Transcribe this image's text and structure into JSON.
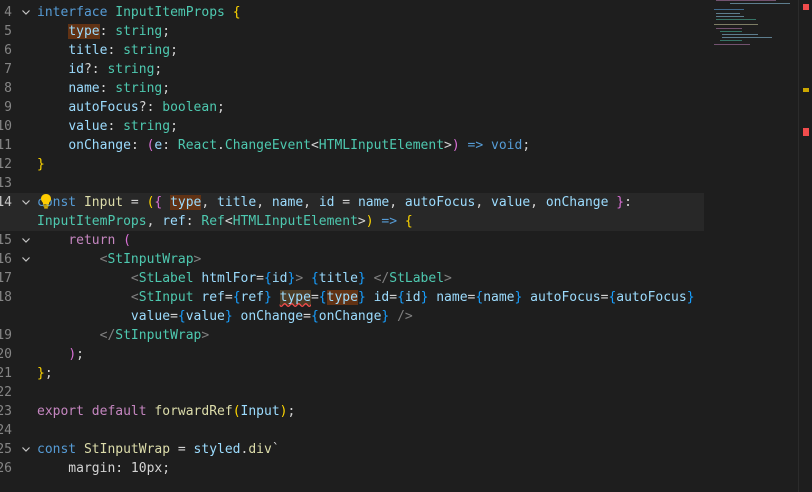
{
  "editor": {
    "language": "typescriptreact",
    "active_line": "14",
    "lines": [
      {
        "n": "4",
        "fold": "open",
        "segs": [
          [
            "kw",
            "interface "
          ],
          [
            "ty",
            "InputItemProps "
          ],
          [
            "b1",
            "{"
          ]
        ]
      },
      {
        "n": "5",
        "segs": [
          [
            "txt",
            "    "
          ],
          [
            "vr hl",
            "type"
          ],
          [
            "txt",
            ": "
          ],
          [
            "ty",
            "string"
          ],
          [
            "txt",
            ";"
          ]
        ]
      },
      {
        "n": "6",
        "segs": [
          [
            "txt",
            "    "
          ],
          [
            "vr",
            "title"
          ],
          [
            "txt",
            ": "
          ],
          [
            "ty",
            "string"
          ],
          [
            "txt",
            ";"
          ]
        ]
      },
      {
        "n": "7",
        "segs": [
          [
            "txt",
            "    "
          ],
          [
            "vr",
            "id"
          ],
          [
            "txt",
            "?: "
          ],
          [
            "ty",
            "string"
          ],
          [
            "txt",
            ";"
          ]
        ]
      },
      {
        "n": "8",
        "segs": [
          [
            "txt",
            "    "
          ],
          [
            "vr",
            "name"
          ],
          [
            "txt",
            ": "
          ],
          [
            "ty",
            "string"
          ],
          [
            "txt",
            ";"
          ]
        ]
      },
      {
        "n": "9",
        "segs": [
          [
            "txt",
            "    "
          ],
          [
            "vr",
            "autoFocus"
          ],
          [
            "txt",
            "?: "
          ],
          [
            "ty",
            "boolean"
          ],
          [
            "txt",
            ";"
          ]
        ]
      },
      {
        "n": "10",
        "segs": [
          [
            "txt",
            "    "
          ],
          [
            "vr",
            "value"
          ],
          [
            "txt",
            ": "
          ],
          [
            "ty",
            "string"
          ],
          [
            "txt",
            ";"
          ]
        ]
      },
      {
        "n": "11",
        "segs": [
          [
            "txt",
            "    "
          ],
          [
            "vr",
            "onChange"
          ],
          [
            "txt",
            ": "
          ],
          [
            "b2",
            "("
          ],
          [
            "vr",
            "e"
          ],
          [
            "txt",
            ": "
          ],
          [
            "ty",
            "React"
          ],
          [
            "txt",
            "."
          ],
          [
            "ty",
            "ChangeEvent"
          ],
          [
            "txt",
            "<"
          ],
          [
            "ty",
            "HTMLInputElement"
          ],
          [
            "txt",
            ">"
          ],
          [
            "b2",
            ")"
          ],
          [
            "txt",
            " "
          ],
          [
            "kw",
            "=>"
          ],
          [
            "txt",
            " "
          ],
          [
            "kw",
            "void"
          ],
          [
            "txt",
            ";"
          ]
        ]
      },
      {
        "n": "12",
        "segs": [
          [
            "b1",
            "}"
          ]
        ]
      },
      {
        "n": "13",
        "segs": []
      },
      {
        "n": "14",
        "fold": "open",
        "active": true,
        "segs": [
          [
            "kw",
            "const "
          ],
          [
            "fn",
            "Input"
          ],
          [
            "txt",
            " = "
          ],
          [
            "b1",
            "("
          ],
          [
            "b2",
            "{ "
          ],
          [
            "vr hl",
            "type"
          ],
          [
            "txt",
            ", "
          ],
          [
            "vr",
            "title"
          ],
          [
            "txt",
            ", "
          ],
          [
            "vr",
            "name"
          ],
          [
            "txt",
            ", "
          ],
          [
            "vr",
            "id"
          ],
          [
            "txt",
            " = "
          ],
          [
            "vr",
            "name"
          ],
          [
            "txt",
            ", "
          ],
          [
            "vr",
            "autoFocus"
          ],
          [
            "txt",
            ", "
          ],
          [
            "vr",
            "value"
          ],
          [
            "txt",
            ", "
          ],
          [
            "vr",
            "onChange"
          ],
          [
            "txt",
            " "
          ],
          [
            "b2",
            "}"
          ],
          [
            "txt",
            ":"
          ]
        ]
      },
      {
        "n": "",
        "segs": [
          [
            "ty",
            "InputItemProps"
          ],
          [
            "txt",
            ", "
          ],
          [
            "vr",
            "ref"
          ],
          [
            "txt",
            ": "
          ],
          [
            "ty",
            "Ref"
          ],
          [
            "txt",
            "<"
          ],
          [
            "ty",
            "HTMLInputElement"
          ],
          [
            "txt",
            ">"
          ],
          [
            "b1",
            ")"
          ],
          [
            "txt",
            " "
          ],
          [
            "kw",
            "=>"
          ],
          [
            "txt",
            " "
          ],
          [
            "b1",
            "{"
          ]
        ]
      },
      {
        "n": "15",
        "fold": "open",
        "segs": [
          [
            "txt",
            "    "
          ],
          [
            "ctl",
            "return"
          ],
          [
            "txt",
            " "
          ],
          [
            "b2",
            "("
          ]
        ]
      },
      {
        "n": "16",
        "fold": "open",
        "segs": [
          [
            "txt",
            "        "
          ],
          [
            "pn",
            "<"
          ],
          [
            "tg",
            "StInputWrap"
          ],
          [
            "pn",
            ">"
          ]
        ]
      },
      {
        "n": "17",
        "segs": [
          [
            "txt",
            "            "
          ],
          [
            "pn",
            "<"
          ],
          [
            "tg",
            "StLabel"
          ],
          [
            "txt",
            " "
          ],
          [
            "vr",
            "htmlFor"
          ],
          [
            "txt",
            "="
          ],
          [
            "b3",
            "{"
          ],
          [
            "vr",
            "id"
          ],
          [
            "b3",
            "}"
          ],
          [
            "pn",
            ">"
          ],
          [
            "txt",
            " "
          ],
          [
            "b3",
            "{"
          ],
          [
            "vr",
            "title"
          ],
          [
            "b3",
            "}"
          ],
          [
            "txt",
            " "
          ],
          [
            "pn",
            "</"
          ],
          [
            "tg",
            "StLabel"
          ],
          [
            "pn",
            ">"
          ]
        ]
      },
      {
        "n": "18",
        "segs": [
          [
            "txt",
            "            "
          ],
          [
            "pn",
            "<"
          ],
          [
            "tg",
            "StInput"
          ],
          [
            "txt",
            " "
          ],
          [
            "vr",
            "ref"
          ],
          [
            "txt",
            "="
          ],
          [
            "b3",
            "{"
          ],
          [
            "vr",
            "ref"
          ],
          [
            "b3",
            "}"
          ],
          [
            "txt",
            " "
          ],
          [
            "vr hl2 squig",
            "type"
          ],
          [
            "txt",
            "="
          ],
          [
            "b3",
            "{"
          ],
          [
            "vr hl",
            "type"
          ],
          [
            "b3",
            "}"
          ],
          [
            "txt",
            " "
          ],
          [
            "vr",
            "id"
          ],
          [
            "txt",
            "="
          ],
          [
            "b3",
            "{"
          ],
          [
            "vr",
            "id"
          ],
          [
            "b3",
            "}"
          ],
          [
            "txt",
            " "
          ],
          [
            "vr",
            "name"
          ],
          [
            "txt",
            "="
          ],
          [
            "b3",
            "{"
          ],
          [
            "vr",
            "name"
          ],
          [
            "b3",
            "}"
          ],
          [
            "txt",
            " "
          ],
          [
            "vr",
            "autoFocus"
          ],
          [
            "txt",
            "="
          ],
          [
            "b3",
            "{"
          ],
          [
            "vr",
            "autoFocus"
          ],
          [
            "b3",
            "}"
          ]
        ]
      },
      {
        "n": "",
        "segs": [
          [
            "txt",
            "            "
          ],
          [
            "vr",
            "value"
          ],
          [
            "txt",
            "="
          ],
          [
            "b3",
            "{"
          ],
          [
            "vr",
            "value"
          ],
          [
            "b3",
            "}"
          ],
          [
            "txt",
            " "
          ],
          [
            "vr",
            "onChange"
          ],
          [
            "txt",
            "="
          ],
          [
            "b3",
            "{"
          ],
          [
            "vr",
            "onChange"
          ],
          [
            "b3",
            "}"
          ],
          [
            "txt",
            " "
          ],
          [
            "pn",
            "/>"
          ]
        ]
      },
      {
        "n": "19",
        "segs": [
          [
            "txt",
            "        "
          ],
          [
            "pn",
            "</"
          ],
          [
            "tg",
            "StInputWrap"
          ],
          [
            "pn",
            ">"
          ]
        ]
      },
      {
        "n": "20",
        "segs": [
          [
            "txt",
            "    "
          ],
          [
            "b2",
            ")"
          ],
          [
            "txt",
            ";"
          ]
        ]
      },
      {
        "n": "21",
        "segs": [
          [
            "b1",
            "}"
          ],
          [
            "txt",
            ";"
          ]
        ]
      },
      {
        "n": "22",
        "segs": []
      },
      {
        "n": "23",
        "segs": [
          [
            "ctl",
            "export"
          ],
          [
            "txt",
            " "
          ],
          [
            "ctl",
            "default"
          ],
          [
            "txt",
            " "
          ],
          [
            "fn",
            "forwardRef"
          ],
          [
            "b1",
            "("
          ],
          [
            "vr",
            "Input"
          ],
          [
            "b1",
            ")"
          ],
          [
            "txt",
            ";"
          ]
        ]
      },
      {
        "n": "24",
        "segs": []
      },
      {
        "n": "25",
        "fold": "open",
        "segs": [
          [
            "kw",
            "const "
          ],
          [
            "fn",
            "StInputWrap"
          ],
          [
            "txt",
            " = "
          ],
          [
            "vr",
            "styled"
          ],
          [
            "txt",
            "."
          ],
          [
            "fn",
            "div"
          ],
          [
            "txt",
            "`"
          ]
        ]
      },
      {
        "n": "26",
        "segs": [
          [
            "txt",
            "    margin: 10px;"
          ]
        ]
      }
    ]
  },
  "colors": {
    "background": "#1e1e1e",
    "current_line": "#282828",
    "lightbulb": "#ffcc00",
    "error_mark": "#f14c4c",
    "warning_mark": "#cca700"
  },
  "icons": {
    "fold": "chevron-down-icon",
    "quick_fix": "lightbulb-icon"
  }
}
